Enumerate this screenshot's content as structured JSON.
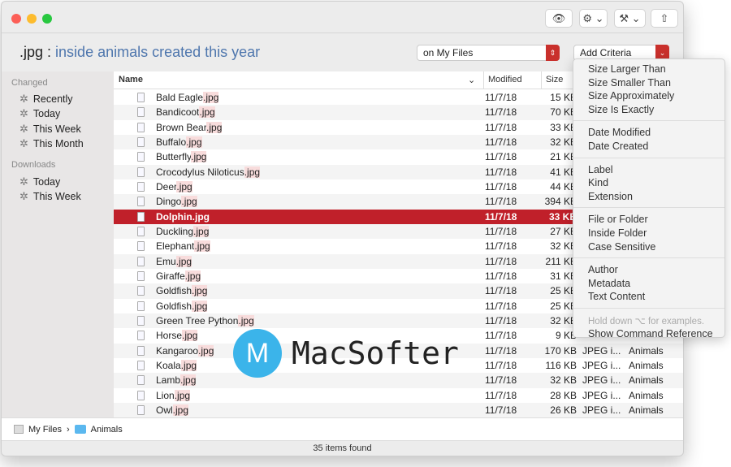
{
  "query": {
    "prefix": ".jpg :",
    "criteria": "inside animals created this year"
  },
  "toolbar": {
    "quicklook": "eye-icon",
    "action": "gear-icon",
    "tools": "tools-icon",
    "share": "share-icon"
  },
  "scope": {
    "label": "on My Files"
  },
  "add_criteria": {
    "label": "Add Criteria"
  },
  "sidebar": {
    "sections": [
      {
        "title": "Changed",
        "items": [
          "Recently",
          "Today",
          "This Week",
          "This Month"
        ]
      },
      {
        "title": "Downloads",
        "items": [
          "Today",
          "This Week"
        ]
      }
    ]
  },
  "columns": {
    "name": "Name",
    "modified": "Modified",
    "size": "Size"
  },
  "files": [
    {
      "name": "Bald Eagle",
      "ext": ".jpg",
      "modified": "11/7/18",
      "size": "15 KB",
      "kind": "",
      "where": ""
    },
    {
      "name": "Bandicoot",
      "ext": ".jpg",
      "modified": "11/7/18",
      "size": "70 KB",
      "kind": "",
      "where": ""
    },
    {
      "name": "Brown Bear",
      "ext": ".jpg",
      "modified": "11/7/18",
      "size": "33 KB",
      "kind": "",
      "where": ""
    },
    {
      "name": "Buffalo",
      "ext": ".jpg",
      "modified": "11/7/18",
      "size": "32 KB",
      "kind": "",
      "where": ""
    },
    {
      "name": "Butterfly",
      "ext": ".jpg",
      "modified": "11/7/18",
      "size": "21 KB",
      "kind": "",
      "where": ""
    },
    {
      "name": "Crocodylus Niloticus",
      "ext": ".jpg",
      "modified": "11/7/18",
      "size": "41 KB",
      "kind": "",
      "where": ""
    },
    {
      "name": "Deer",
      "ext": ".jpg",
      "modified": "11/7/18",
      "size": "44 KB",
      "kind": "",
      "where": ""
    },
    {
      "name": "Dingo",
      "ext": ".jpg",
      "modified": "11/7/18",
      "size": "394 KB",
      "kind": "",
      "where": ""
    },
    {
      "name": "Dolphin",
      "ext": ".jpg",
      "modified": "11/7/18",
      "size": "33 KB",
      "kind": "",
      "where": "",
      "selected": true
    },
    {
      "name": "Duckling",
      "ext": ".jpg",
      "modified": "11/7/18",
      "size": "27 KB",
      "kind": "",
      "where": ""
    },
    {
      "name": "Elephant",
      "ext": ".jpg",
      "modified": "11/7/18",
      "size": "32 KB",
      "kind": "",
      "where": ""
    },
    {
      "name": "Emu",
      "ext": ".jpg",
      "modified": "11/7/18",
      "size": "211 KB",
      "kind": "",
      "where": ""
    },
    {
      "name": "Giraffe",
      "ext": ".jpg",
      "modified": "11/7/18",
      "size": "31 KB",
      "kind": "",
      "where": ""
    },
    {
      "name": "Goldfish",
      "ext": ".jpg",
      "modified": "11/7/18",
      "size": "25 KB",
      "kind": "",
      "where": ""
    },
    {
      "name": "Goldfish",
      "ext": ".jpg",
      "modified": "11/7/18",
      "size": "25 KB",
      "kind": "",
      "where": ""
    },
    {
      "name": "Green Tree Python",
      "ext": ".jpg",
      "modified": "11/7/18",
      "size": "32 KB",
      "kind": "",
      "where": ""
    },
    {
      "name": "Horse",
      "ext": ".jpg",
      "modified": "11/7/18",
      "size": "9 KB",
      "kind": "",
      "where": ""
    },
    {
      "name": "Kangaroo",
      "ext": ".jpg",
      "modified": "11/7/18",
      "size": "170 KB",
      "kind": "JPEG i...",
      "where": "Animals"
    },
    {
      "name": "Koala",
      "ext": ".jpg",
      "modified": "11/7/18",
      "size": "116 KB",
      "kind": "JPEG i...",
      "where": "Animals"
    },
    {
      "name": "Lamb",
      "ext": ".jpg",
      "modified": "11/7/18",
      "size": "32 KB",
      "kind": "JPEG i...",
      "where": "Animals"
    },
    {
      "name": "Lion",
      "ext": ".jpg",
      "modified": "11/7/18",
      "size": "28 KB",
      "kind": "JPEG i...",
      "where": "Animals"
    },
    {
      "name": "Owl",
      "ext": ".jpg",
      "modified": "11/7/18",
      "size": "26 KB",
      "kind": "JPEG i...",
      "where": "Animals"
    }
  ],
  "menu": {
    "groups": [
      [
        "Size Larger Than",
        "Size Smaller Than",
        "Size Approximately",
        "Size Is Exactly"
      ],
      [
        "Date Modified",
        "Date Created"
      ],
      [
        "Label",
        "Kind",
        "Extension"
      ],
      [
        "File or Folder",
        "Inside Folder",
        "Case Sensitive"
      ],
      [
        "Author",
        "Metadata",
        "Text Content"
      ]
    ],
    "hint": "Hold down ⌥ for examples.",
    "reference": "Show Command Reference"
  },
  "path": {
    "root": "My Files",
    "folder": "Animals"
  },
  "status": "35 items found",
  "watermark": {
    "initial": "M",
    "text": "MacSofter"
  },
  "colors": {
    "accent": "#c0202a",
    "query_blue": "#4e76ad"
  }
}
